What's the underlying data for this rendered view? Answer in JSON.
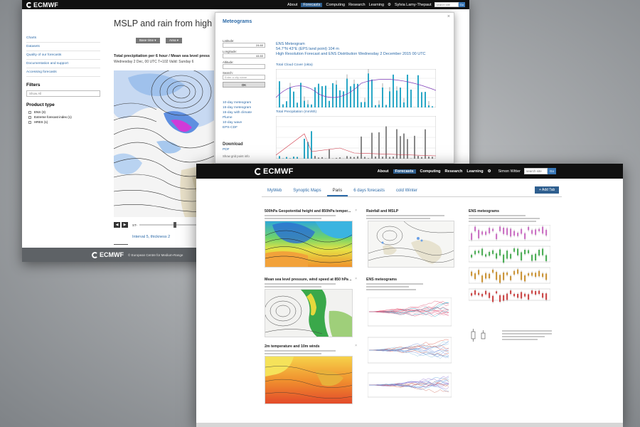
{
  "back": {
    "brand": "ECMWF",
    "nav": [
      "About",
      "Forecasts",
      "Computing",
      "Research",
      "Learning"
    ],
    "nav_active": 1,
    "user": "Sylvia Lamy-Thepaut",
    "search_placeholder": "search site",
    "go_label": "Go",
    "sidebar_links": [
      "Charts",
      "Datasets",
      "Quality of our forecasts",
      "Documentation and support",
      "Accessing forecasts"
    ],
    "filters_heading": "Filters",
    "filter_placeholder": "Show All",
    "product_type_heading": "Product type",
    "product_types": [
      "ENS (3)",
      "Extreme forecast index (1)",
      "HRES (1)"
    ],
    "page_title": "MSLP and rain from high",
    "base_time_btn": "Base time ▾",
    "area_btn": "Area ▾",
    "chart_caption": "Total precipitation per 6 hour / Mean sea level press",
    "chart_subcaption": "Wednesday 2 Dec, 00 UTC T+102 Valid: Sunday 6",
    "player_label": "ST-",
    "interval_link": "Interval 5, thickness 2",
    "footer_brand": "ECMWF",
    "footer_text": "© European Centre for Medium-Range"
  },
  "popup": {
    "title": "Meteograms",
    "close": "×",
    "latitude_label": "Latitude:",
    "latitude_value": "24.60",
    "longitude_label": "Longitude:",
    "longitude_value": "44.60",
    "altitude_label": "Altitude:",
    "altitude_value": "",
    "search_label": "Search:",
    "search_placeholder": "Enter a city name",
    "ok_label": "OK",
    "links": [
      "10-day meteogram",
      "15-day meteogram",
      "15-day with climate",
      "Plume",
      "10-day wave",
      "EPS-CDF"
    ],
    "download_heading": "Download",
    "download_link": "PDF",
    "download_hint": "Show grid point info",
    "line1": "ENS Meteogram",
    "line2": "54.7°N 43°E (EPS land point) 104 m",
    "line3": "High Resolution Forecast and ENS Distribution Wednesday 2 December 2015 00 UTC",
    "chart1_label": "Total Cloud Cover (okta)",
    "chart2_label": "Total Precipitation (mm/6h)"
  },
  "front": {
    "brand": "ECMWF",
    "nav": [
      "About",
      "Forecasts",
      "Computing",
      "Research",
      "Learning"
    ],
    "nav_active": 1,
    "user": "Simon Witter",
    "search_placeholder": "search site",
    "go_label": "Go",
    "tabs": [
      "MyWeb",
      "Synoptic Maps",
      "Paris",
      "6 days forecasts",
      "cold Winter"
    ],
    "active_tab": 2,
    "add_tab": "+ Add Tab",
    "cards": {
      "geopotential": "500hPa Geopotential height and 850hPa temper...",
      "rainfall": "Rainfall and MSLP",
      "ens_meteograms_right": "ENS meteograms",
      "mslp_wind": "Mean sea level pressure, wind speed at 850 hPa ...",
      "ens_meteograms_mid": "ENS meteograms",
      "temp_wind": "2m temperature and 10m winds"
    },
    "card_close": "×",
    "colors": {
      "accent": "#2f5f8f",
      "link": "#2c6aa8",
      "topbar": "#111111"
    }
  }
}
